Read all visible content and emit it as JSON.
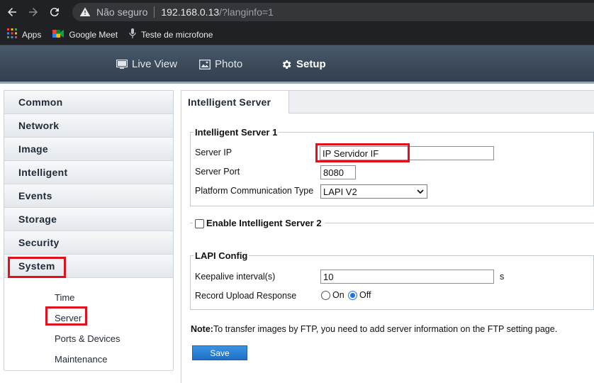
{
  "browser": {
    "security_label": "Não seguro",
    "url_host": "192.168.0.13",
    "url_path": "/?langinfo=1",
    "bookmarks": [
      {
        "label": "Apps",
        "icon": "apps-grid-icon"
      },
      {
        "label": "Google Meet",
        "icon": "google-meet-icon"
      },
      {
        "label": "Teste de microfone",
        "icon": "microphone-icon"
      }
    ]
  },
  "header": {
    "tabs": [
      {
        "label": "Live View",
        "icon": "monitor-icon"
      },
      {
        "label": "Photo",
        "icon": "photo-icon"
      },
      {
        "label": "Setup",
        "icon": "gear-icon",
        "active": true
      }
    ]
  },
  "sidebar": {
    "items": [
      {
        "label": "Common"
      },
      {
        "label": "Network"
      },
      {
        "label": "Image"
      },
      {
        "label": "Intelligent"
      },
      {
        "label": "Events"
      },
      {
        "label": "Storage"
      },
      {
        "label": "Security"
      },
      {
        "label": "System",
        "expanded": true
      }
    ],
    "subitems": [
      {
        "label": "Time"
      },
      {
        "label": "Server",
        "selected": true
      },
      {
        "label": "Ports & Devices"
      },
      {
        "label": "Maintenance"
      }
    ]
  },
  "main": {
    "tab_label": "Intelligent Server",
    "server1": {
      "legend": "Intelligent Server 1",
      "server_ip_label": "Server IP",
      "server_ip_value": " IP Servidor IF",
      "server_port_label": "Server Port",
      "server_port_value": "8080",
      "platform_label": "Platform Communication Type",
      "platform_value": "LAPI V2"
    },
    "server2": {
      "legend": "Enable Intelligent Server 2",
      "enabled": false
    },
    "lapi": {
      "legend": "LAPI Config",
      "keepalive_label": "Keepalive interval(s)",
      "keepalive_value": "10",
      "keepalive_unit": "s",
      "upload_label": "Record Upload Response",
      "on_label": "On",
      "off_label": "Off",
      "selected": "Off"
    },
    "note_prefix": "Note:",
    "note_text": "To transfer images by FTP, you need to add server information on the FTP setting page.",
    "save_label": "Save"
  },
  "colors": {
    "highlight": "#e0101c",
    "header_bg": "#3a4858",
    "save_button": "#2a80d6"
  }
}
